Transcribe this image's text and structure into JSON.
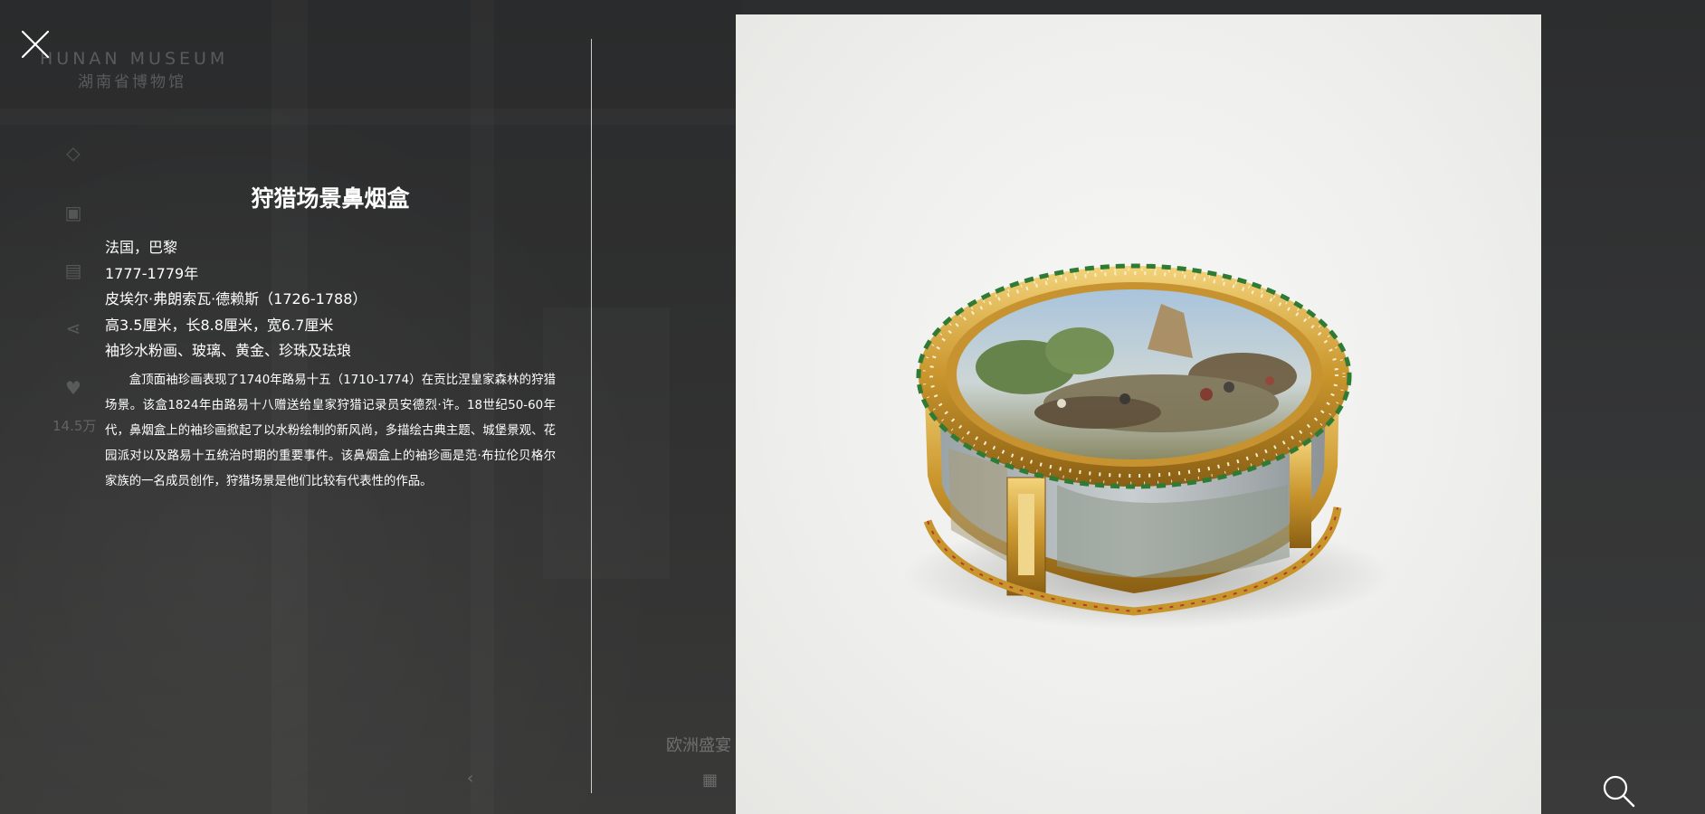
{
  "background": {
    "logo_en": "HUNAN MUSEUM",
    "logo_cn": "湖南省博物馆",
    "like_count": "14.5万",
    "caption": "欧洲盛宴"
  },
  "close_icon": "close-icon",
  "search_icon": "search-icon",
  "artifact": {
    "title": "狩猎场景鼻烟盒",
    "origin": "法国，巴黎",
    "date": "1777-1779年",
    "maker": "皮埃尔·弗朗索瓦·德赖斯（1726-1788）",
    "dimensions": "高3.5厘米，长8.8厘米，宽6.7厘米",
    "materials": "袖珍水粉画、玻璃、黄金、珍珠及珐琅",
    "description": "盒顶面袖珍画表现了1740年路易十五（1710-1774）在贡比涅皇家森林的狩猎场景。该盒1824年由路易十八赠送给皇家狩猎记录员安德烈·许。18世纪50-60年代，鼻烟盒上的袖珍画掀起了以水粉绘制的新风尚，多描绘古典主题、城堡景观、花园派对以及路易十五统治时期的重要事件。该鼻烟盒上的袖珍画是范·布拉伦贝格尔家族的一名成员创作，狩猎场景是他们比较有代表性的作品。"
  },
  "colors": {
    "overlay": "#2e2f30",
    "text": "#ffffff",
    "gold": "#d4a73a"
  }
}
